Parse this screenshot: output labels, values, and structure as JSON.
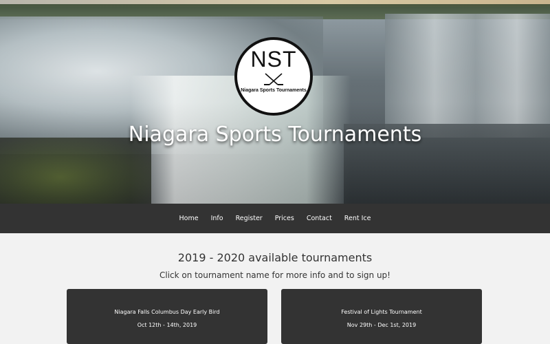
{
  "hero": {
    "logo_letters": "NST",
    "logo_subtitle": "Niagara Sports Tournaments",
    "title": "Niagara Sports Tournaments"
  },
  "nav": {
    "items": [
      "Home",
      "Info",
      "Register",
      "Prices",
      "Contact",
      "Rent Ice"
    ]
  },
  "main": {
    "heading": "2019 - 2020 available tournaments",
    "subheading": "Click on tournament name for more info and to sign up!"
  },
  "tournaments": [
    {
      "name": "Niagara Falls Columbus Day Early Bird",
      "dates": "Oct 12th - 14th, 2019"
    },
    {
      "name": "Festival of Lights Tournament",
      "dates": "Nov 29th - Dec 1st, 2019"
    }
  ],
  "colors": {
    "nav_bg": "#333333",
    "page_bg": "#f2f2f2",
    "card_bg": "#333333"
  }
}
